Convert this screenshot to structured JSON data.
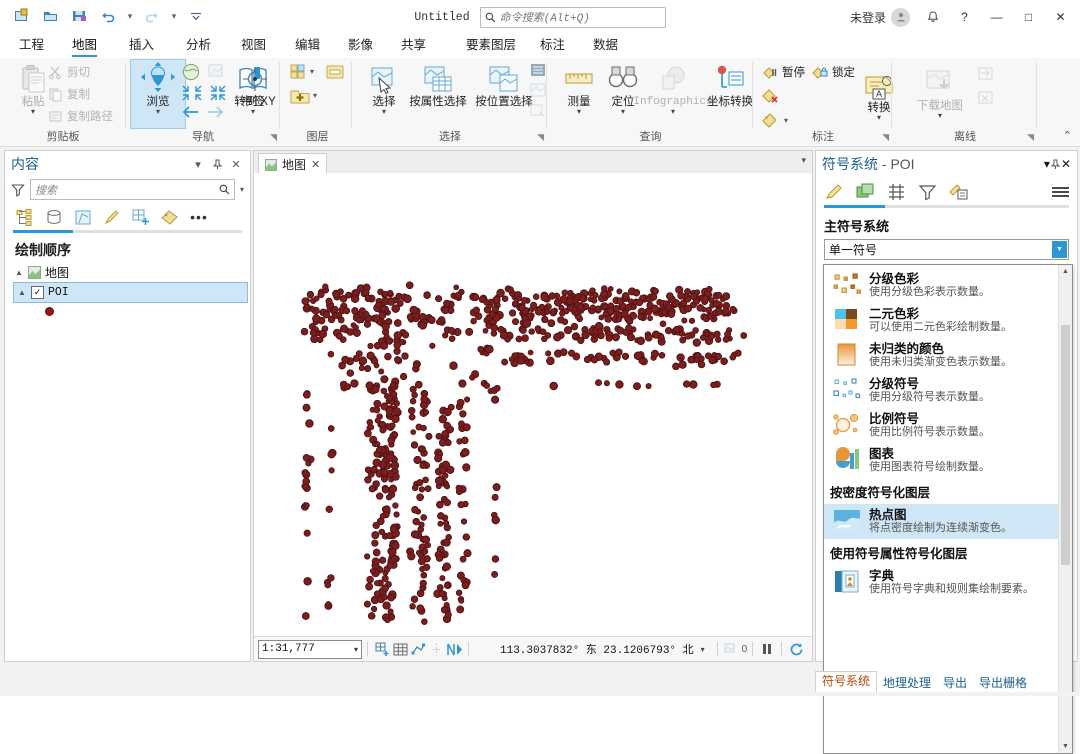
{
  "window": {
    "title": "Untitled",
    "search_placeholder": "命令搜索(Alt+Q)",
    "account_label": "未登录",
    "quick_access": [
      "new-project-icon",
      "open-project-icon",
      "save-project-icon",
      "undo-icon",
      "redo-icon",
      "customize-qat-icon"
    ],
    "buttons": {
      "minimize": "—",
      "maximize": "□",
      "close": "✕",
      "help": "?",
      "notifications": "bell-icon"
    }
  },
  "ribbon": {
    "tabs": [
      "工程",
      "地图",
      "插入",
      "分析",
      "视图",
      "编辑",
      "影像",
      "共享"
    ],
    "active_tab": "地图",
    "contextual_tabs": [
      "要素图层",
      "标注",
      "数据"
    ],
    "groups": [
      {
        "title": "剪贴板",
        "big": [
          {
            "label": "粘贴",
            "dropdown": true,
            "disabled": true
          }
        ],
        "small": [
          {
            "label": "剪切",
            "disabled": true,
            "icon": "scissors-icon"
          },
          {
            "label": "复制",
            "disabled": true,
            "icon": "copy-icon"
          },
          {
            "label": "复制路径",
            "disabled": true,
            "icon": "copy-path-icon"
          }
        ]
      },
      {
        "title": "导航",
        "big": [
          {
            "label": "浏览",
            "dropdown": true,
            "selected": true,
            "icon": "explore-icon"
          },
          {
            "label": "书签",
            "dropdown": true,
            "icon": "bookmarks-icon"
          },
          {
            "label": "转到 XY",
            "dropdown": false,
            "icon": "go-to-xy-icon"
          }
        ]
      },
      {
        "title": "图层",
        "big": [],
        "small": [
          {
            "label": "",
            "icon": "add-data-icon"
          },
          {
            "label": "",
            "icon": "basemap-icon"
          }
        ]
      },
      {
        "title": "选择",
        "big": [
          {
            "label": "选择",
            "dropdown": true,
            "icon": "select-icon"
          },
          {
            "label": "按属性选择",
            "dropdown": false,
            "icon": "select-by-attribute-icon"
          },
          {
            "label": "按位置选择",
            "dropdown": false,
            "icon": "select-by-location-icon"
          }
        ]
      },
      {
        "title": "查询",
        "big": [
          {
            "label": "测量",
            "dropdown": true,
            "icon": "measure-icon"
          },
          {
            "label": "定位",
            "dropdown": true,
            "icon": "locate-icon"
          },
          {
            "label": "Infographics",
            "dropdown": true,
            "disabled": true,
            "icon": "infographics-icon"
          },
          {
            "label": "坐标转换",
            "dropdown": false,
            "icon": "coordinate-conversion-icon"
          }
        ]
      },
      {
        "title": "标注",
        "small": [
          {
            "label": "暂停",
            "icon": "pause-labeling-icon"
          },
          {
            "label": "锁定",
            "icon": "lock-labeling-icon"
          },
          {
            "label": "",
            "icon": "clear-label-icon"
          },
          {
            "label": "",
            "icon": "label-style-icon"
          }
        ],
        "big": [
          {
            "label": "转换",
            "dropdown": true,
            "icon": "convert-labels-icon"
          }
        ]
      },
      {
        "title": "离线",
        "big": [
          {
            "label": "下载地图",
            "dropdown": true,
            "disabled": true,
            "icon": "download-map-icon"
          }
        ],
        "small": [
          {
            "label": "",
            "disabled": true,
            "icon": "sync-icon"
          },
          {
            "label": "",
            "disabled": true,
            "icon": "remove-replica-icon"
          }
        ]
      }
    ],
    "collapse_icon": "chevron-up-icon"
  },
  "contents_pane": {
    "title": "内容",
    "search_placeholder": "搜索",
    "toolbar_icons": [
      "list-by-drawing-order-icon",
      "list-by-data-source-icon",
      "list-by-selection-icon",
      "list-by-editing-icon",
      "list-by-snapping-icon",
      "list-by-labeling-icon",
      "more-options-icon"
    ],
    "section_title": "绘制顺序",
    "tree": [
      {
        "label": "地图",
        "type": "map",
        "expanded": true
      },
      {
        "label": "POI",
        "type": "layer",
        "checked": true,
        "selected": true,
        "expanded": true
      }
    ],
    "legend_symbol_color": "#8b1a1a"
  },
  "map_view": {
    "tab_label": "地图",
    "close_label": "✕",
    "scale": "1:31,777",
    "coordinates": "113.3037832° 东  23.1206793° 北",
    "coordinate_unit_dropdown": "北",
    "selected_count": "0",
    "status_icons": [
      "insert-grid-icon",
      "grid-icon",
      "snapping-icon",
      "edit-vertices-icon",
      "north-arrow-icon",
      "selected-features-icon",
      "pause-drawing-icon",
      "refresh-icon"
    ]
  },
  "symbology_pane": {
    "title_main": "符号系统",
    "title_sep": " - ",
    "title_layer": "POI",
    "toolbar_icons": [
      "gallery-icon",
      "properties-icon",
      "variables-icon",
      "filter-icon",
      "annotate-icon",
      "menu-icon"
    ],
    "primary_label": "主符号系统",
    "selected_value": "单一符号",
    "dropdown_options": [
      {
        "title": "分级色彩",
        "desc": "使用分级色彩表示数量。",
        "icon": "graduated-colors-icon",
        "selected": false
      },
      {
        "title": "二元色彩",
        "desc": "可以使用二元色彩绘制数量。",
        "icon": "bivariate-colors-icon",
        "selected": false
      },
      {
        "title": "未归类的颜色",
        "desc": "使用未归类渐变色表示数量。",
        "icon": "unclassed-colors-icon",
        "selected": false
      },
      {
        "title": "分级符号",
        "desc": "使用分级符号表示数量。",
        "icon": "graduated-symbols-icon",
        "selected": false
      },
      {
        "title": "比例符号",
        "desc": "使用比例符号表示数量。",
        "icon": "proportional-symbols-icon",
        "selected": false
      },
      {
        "title": "图表",
        "desc": "使用图表符号绘制数量。",
        "icon": "charts-icon",
        "selected": false
      }
    ],
    "group_headers": [
      {
        "label": "按密度符号化图层",
        "after_index": 6
      },
      {
        "label": "使用符号属性符号化图层",
        "after_index": 7
      }
    ],
    "dropdown_options_2": [
      {
        "title": "热点图",
        "desc": "将点密度绘制为连续渐变色。",
        "icon": "heat-map-icon",
        "selected": true
      }
    ],
    "dropdown_options_3": [
      {
        "title": "字典",
        "desc": "使用符号字典和规则集绘制要素。",
        "icon": "dictionary-icon",
        "selected": false
      }
    ]
  },
  "dock_tabs": {
    "items": [
      "符号系统",
      "地理处理",
      "导出",
      "导出栅格"
    ],
    "active": "符号系统"
  },
  "colors": {
    "accent": "#2b97d4",
    "title_blue": "#1d5f8a",
    "selection": "#cfe6f7",
    "point_fill": "#7a1f1f",
    "point_stroke": "#4d1010",
    "ribbon_bg": "#f7f7f7"
  }
}
